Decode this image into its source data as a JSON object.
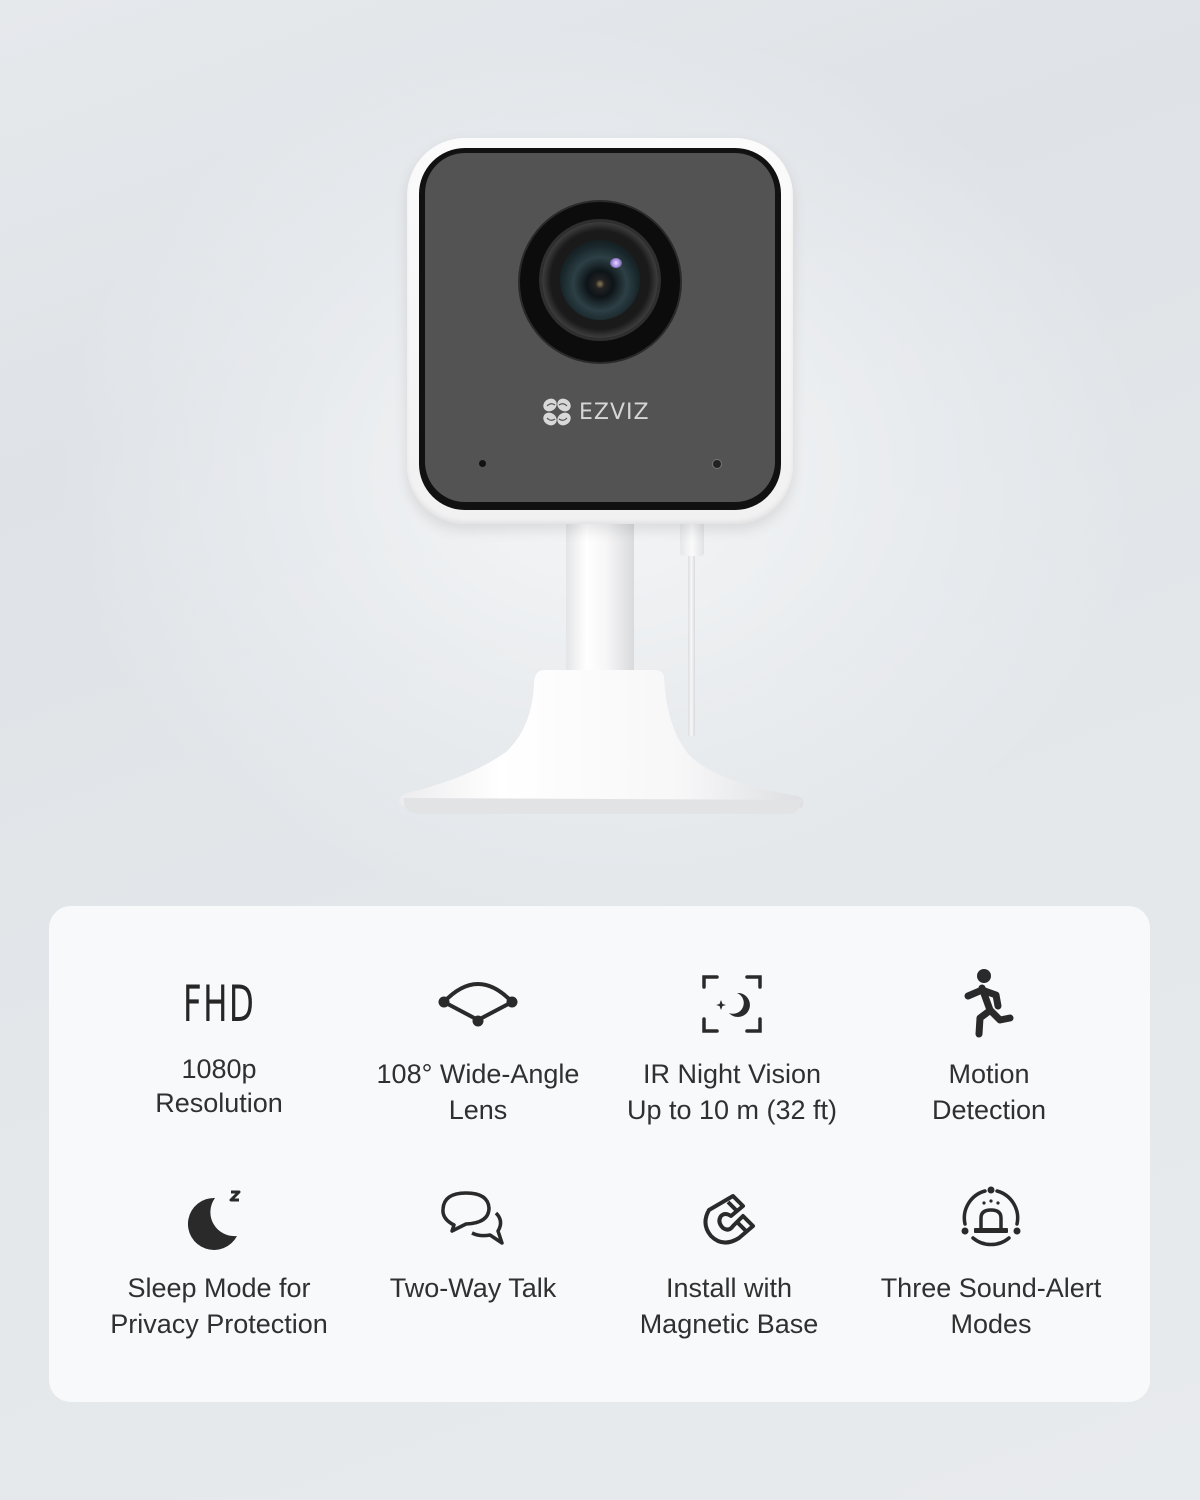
{
  "product": {
    "brand": "EZVIZ",
    "image_alt": "EZVIZ indoor camera on white stand"
  },
  "colors": {
    "background": "#e3e7ea",
    "card": "#f8f9fa",
    "text": "#303030",
    "camera_face": "#535353",
    "camera_shell": "#f5f5f6"
  },
  "features": [
    {
      "icon": "fhd-icon",
      "icon_text": "FHD",
      "line1": "1080p",
      "line2": "Resolution"
    },
    {
      "icon": "wide-angle-lens-icon",
      "line1": "108° Wide-Angle",
      "line2": "Lens"
    },
    {
      "icon": "night-vision-icon",
      "line1": "IR Night Vision",
      "line2": "Up to 10 m (32 ft)"
    },
    {
      "icon": "running-person-icon",
      "line1": "Motion",
      "line2": "Detection"
    },
    {
      "icon": "sleep-moon-icon",
      "line1": "Sleep Mode for",
      "line2": "Privacy Protection"
    },
    {
      "icon": "chat-bubbles-icon",
      "line1": "Two-Way Talk",
      "line2": ""
    },
    {
      "icon": "magnet-icon",
      "line1": "Install with",
      "line2": "Magnetic Base"
    },
    {
      "icon": "siren-alarm-icon",
      "line1": "Three Sound-Alert",
      "line2": "Modes"
    }
  ]
}
